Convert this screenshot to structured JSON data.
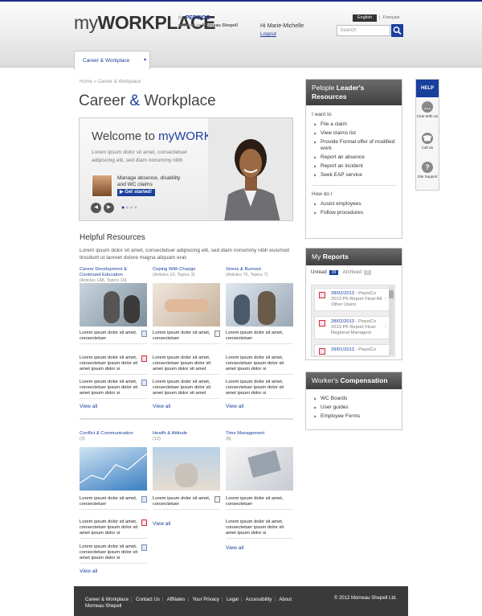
{
  "header": {
    "logo_my": "my",
    "logo_workplace": "WORKPLACE",
    "for_text": "for",
    "pepsico": "PEPSICO",
    "powered_by": "powered by",
    "morneau": "Morneau Shepell",
    "greeting_hi": "Hi",
    "user_name": "Marie-Michelle",
    "logout": "Logout",
    "lang_en": "English",
    "lang_sep": "|",
    "lang_fr": "Français",
    "search_placeholder": "Search",
    "search_icon": "search-icon"
  },
  "nav": {
    "tab_label": "Career & Workplace",
    "tab_chevron": "▾"
  },
  "breadcrumb": {
    "home": "Home",
    "sep": "»",
    "current": "Career & Workplace"
  },
  "page_title": {
    "part1": "Career",
    "amp": "&",
    "part2": "Workplace"
  },
  "hero": {
    "welcome": "Welcome to",
    "brand": "myWORKPLACE",
    "lorem": "Lorem ipsum dolor sit amet, consectetuer adipiscing elit, sed diam nonummy nibh",
    "manage": "Manage absence, disability and WC claims",
    "get_started": "Get started!",
    "prev": "◀",
    "next": "▶"
  },
  "helpful": {
    "title": "Helpful Resources",
    "intro": "Lorem ipsum dolor sit amet, consectetuer adipiscing elit, sed diam nonummy nibh euismod tincidunt ut laoreet dolore magna aliquam erat.",
    "view_all": "View all",
    "cols": [
      {
        "cat": "Career Development & Continued Education",
        "meta": "(Articles 148, Topics 19)"
      },
      {
        "cat": "Coping With Change",
        "meta": "(Articles 10, Topics 3)"
      },
      {
        "cat": "Stress & Burnout",
        "meta": "(Articles 76, Topics 7)"
      },
      {
        "cat": "Conflict & Communication",
        "meta": "(3)"
      },
      {
        "cat": "Health & Attitude",
        "meta": "(12)"
      },
      {
        "cat": "Time Management",
        "meta": "(8)"
      }
    ],
    "art_short": "Lorem ipsum dolor sit amet, consectetuer",
    "art_long": "Lorem ipsum dolor sit amet, consectetuer ipsum dolor sit amet ipsum dolor si",
    "art_long_b": "Lorem ipsum dolor sit amet, consectetuer ipsum dolor sit amet ipsum dolor sit amet"
  },
  "leader": {
    "title_pre": "Pelople",
    "title_bold": "Leader's Resources",
    "i_want_to": "I want to",
    "items": [
      "File a claim",
      "View claims list",
      "Provide Formal offer of modified work",
      "Report an absence",
      "Report an incident",
      "Seek EAP service"
    ],
    "how_do_i": "How do I",
    "how_items": [
      "Assist employees",
      "Follow procedures"
    ]
  },
  "help": {
    "label": "HELP",
    "chat": "Chat With Us",
    "call": "Call Us",
    "site": "Site Support"
  },
  "reports": {
    "title_pre": "My",
    "title_bold": "Reports",
    "unread": "Unread",
    "unread_count": "39",
    "archived": "Archived",
    "archived_count": "0",
    "items": [
      {
        "date": "28/02/2013",
        "text": "- PepsiCo 2013 P6 Report Final-All Other Users"
      },
      {
        "date": "28/02/2013",
        "text": "- PepsiCo 2013 P6 Report Final-Regional Managers"
      },
      {
        "date": "29/01/2013",
        "text": "- PepsiCo"
      }
    ]
  },
  "comp": {
    "title_pre": "Worker's",
    "title_bold": "Compensation",
    "items": [
      "WC Boards",
      "User guides",
      "Employee Forms"
    ]
  },
  "footer": {
    "links": [
      "Career & Workplace",
      "Contact Us",
      "Affiliates",
      "Your Privacy",
      "Legal",
      "Accessibility",
      "About"
    ],
    "morneau": "Morneau Shepell",
    "copyright": "© 2012 Morneau Shepell Ltd."
  }
}
